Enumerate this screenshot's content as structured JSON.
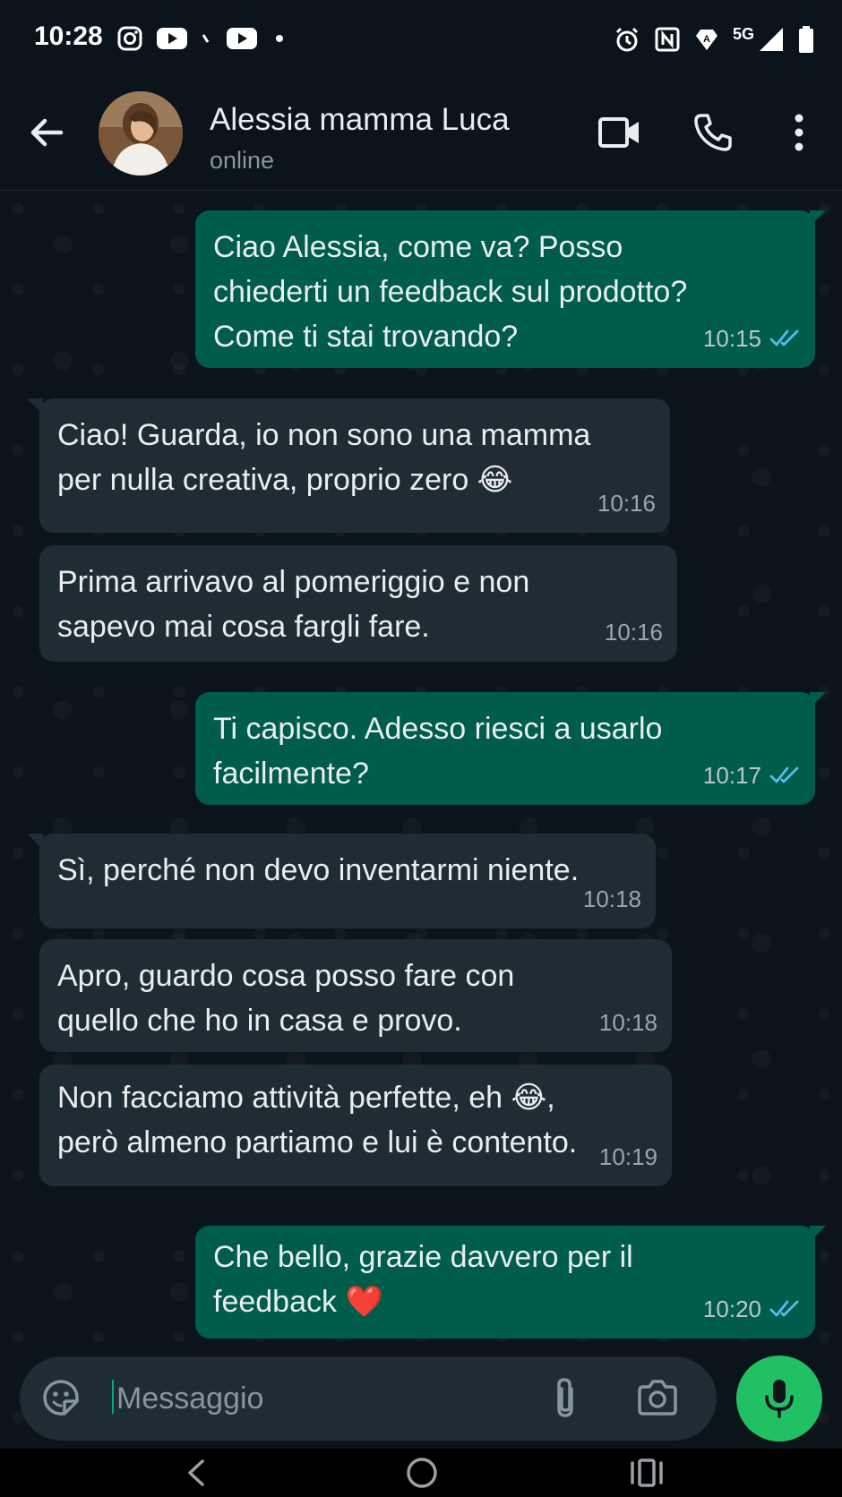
{
  "status_bar": {
    "time": "10:28",
    "network": "5G"
  },
  "header": {
    "contact_name": "Alessia mamma Luca",
    "contact_status": "online"
  },
  "messages": [
    {
      "direction": "out",
      "text": "Ciao Alessia, come va? Posso\nchiederti un feedback sul prodotto?\nCome ti stai trovando?",
      "time": "10:15",
      "read": true
    },
    {
      "direction": "in",
      "text": "Ciao! Guarda, io non sono una mamma\nper nulla creativa, proprio zero 😂",
      "time": "10:16"
    },
    {
      "direction": "in",
      "text": "Prima arrivavo al pomeriggio e non\nsapevo mai cosa fargli fare.",
      "time": "10:16"
    },
    {
      "direction": "out",
      "text": "Ti capisco. Adesso riesci a usarlo\nfacilmente?",
      "time": "10:17",
      "read": true
    },
    {
      "direction": "in",
      "text": "Sì, perché non devo inventarmi niente.",
      "time": "10:18"
    },
    {
      "direction": "in",
      "text": "Apro, guardo cosa posso fare con\nquello che ho in casa e provo.",
      "time": "10:18"
    },
    {
      "direction": "in",
      "text": "Non facciamo attività perfette, eh 😂,\nperò almeno partiamo e lui è contento.",
      "time": "10:19"
    },
    {
      "direction": "out",
      "text": "Che bello, grazie davvero per il\nfeedback ❤️",
      "time": "10:20",
      "read": true
    }
  ],
  "composer": {
    "placeholder": "Messaggio"
  },
  "colors": {
    "background": "#0b141a",
    "outgoing_bubble": "#005c4b",
    "incoming_bubble": "#202c33",
    "accent": "#21c063",
    "read_ticks": "#53bdeb"
  }
}
